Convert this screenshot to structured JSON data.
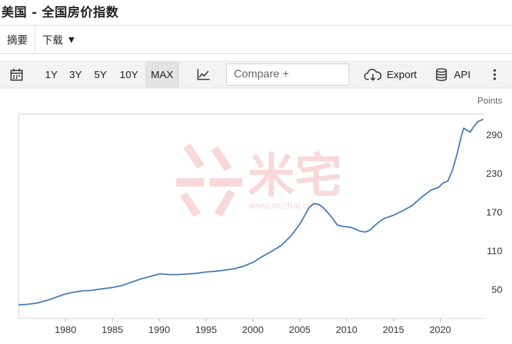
{
  "header": {
    "title": "美国 - 全国房价指数"
  },
  "tabs": [
    {
      "label": "摘要"
    },
    {
      "label": "下载"
    }
  ],
  "toolbar": {
    "ranges": [
      "1Y",
      "3Y",
      "5Y",
      "10Y",
      "MAX"
    ],
    "active_range": "MAX",
    "compare_placeholder": "Compare +",
    "export_label": "Export",
    "api_label": "API"
  },
  "watermark": {
    "brand": "米宅",
    "url": "www.mizhai.com"
  },
  "colors": {
    "line": "#4a7ebb",
    "watermark": "#f3b9b9"
  },
  "chart_data": {
    "type": "line",
    "title": "",
    "xlabel": "",
    "ylabel": "Points",
    "x_ticks": [
      1980,
      1985,
      1990,
      1995,
      2000,
      2005,
      2010,
      2015,
      2020
    ],
    "y_ticks": [
      50,
      110,
      170,
      230,
      290
    ],
    "xlim": [
      1975,
      2024.7
    ],
    "ylim": [
      5,
      322
    ],
    "grid": false,
    "series": [
      {
        "x": [
          1975.0,
          1976.0,
          1977.0,
          1978.0,
          1979.0,
          1980.0,
          1981.0,
          1982.0,
          1982.5,
          1983.0,
          1984.0,
          1985.0,
          1986.0,
          1987.0,
          1988.0,
          1989.0,
          1990.0,
          1990.5,
          1991.0,
          1992.0,
          1993.0,
          1994.0,
          1995.0,
          1996.0,
          1997.0,
          1998.0,
          1999.0,
          2000.0,
          2001.0,
          2002.0,
          2003.0,
          2004.0,
          2005.0,
          2006.0,
          2006.5,
          2007.0,
          2007.5,
          2008.0,
          2008.5,
          2009.0,
          2009.5,
          2010.0,
          2010.5,
          2011.0,
          2011.5,
          2012.0,
          2012.5,
          2013.0,
          2013.5,
          2014.0,
          2015.0,
          2016.0,
          2017.0,
          2018.0,
          2019.0,
          2019.8,
          2020.3,
          2020.8,
          2021.3,
          2021.8,
          2022.2,
          2022.5,
          2022.8,
          2023.2,
          2023.6,
          2024.0,
          2024.6
        ],
        "values": [
          26,
          27,
          29,
          33,
          38,
          43,
          46,
          48,
          48,
          49,
          51,
          53,
          56,
          61,
          66,
          70,
          74,
          74,
          73,
          73,
          74,
          75,
          77,
          78,
          80,
          82,
          86,
          92,
          101,
          109,
          118,
          132,
          151,
          177,
          183,
          182,
          177,
          169,
          160,
          150,
          148,
          147,
          146,
          143,
          140,
          139,
          142,
          149,
          155,
          160,
          165,
          172,
          180,
          193,
          204,
          208,
          215,
          218,
          235,
          260,
          285,
          300,
          297,
          294,
          303,
          310,
          314
        ]
      }
    ]
  }
}
